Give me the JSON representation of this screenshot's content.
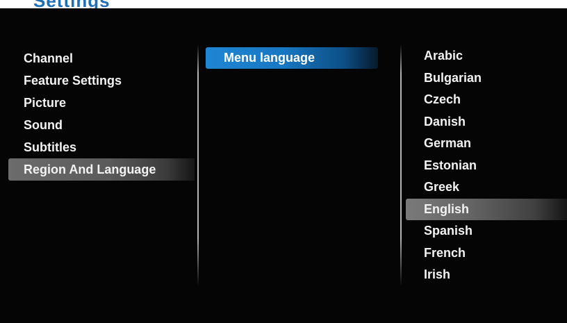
{
  "header": {
    "partial_title": "Settings"
  },
  "left_menu": {
    "items": [
      {
        "label": "Channel"
      },
      {
        "label": "Feature Settings"
      },
      {
        "label": "Picture"
      },
      {
        "label": "Sound"
      },
      {
        "label": "Subtitles"
      },
      {
        "label": "Region And Language"
      }
    ],
    "selected_index": 5
  },
  "middle_menu": {
    "items": [
      {
        "label": "Menu language"
      }
    ],
    "selected_index": 0
  },
  "right_menu": {
    "items": [
      {
        "label": "Arabic"
      },
      {
        "label": "Bulgarian"
      },
      {
        "label": "Czech"
      },
      {
        "label": "Danish"
      },
      {
        "label": "German"
      },
      {
        "label": "Estonian"
      },
      {
        "label": "Greek"
      },
      {
        "label": "English"
      },
      {
        "label": "Spanish"
      },
      {
        "label": "French"
      },
      {
        "label": "Irish"
      }
    ],
    "selected_index": 7
  },
  "colors": {
    "screen_bg": "#050505",
    "highlight_blue": "#1f86d3",
    "highlight_gray": "#6c6c6c",
    "text": "#f2f2f2",
    "heading_blue": "#1d6fb8"
  }
}
